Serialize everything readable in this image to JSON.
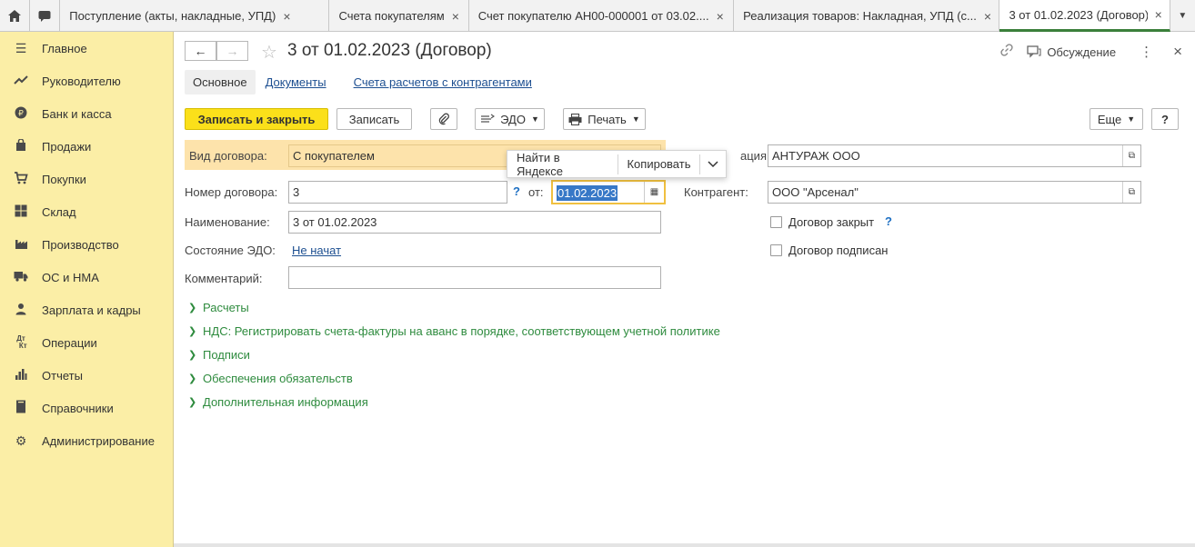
{
  "tabbar": {
    "home_icon": "home-icon",
    "panel_icon": "chat-panel-icon",
    "tabs": [
      {
        "label": "Поступление (акты, накладные, УПД)",
        "close": "×"
      },
      {
        "label": "Счета покупателям",
        "close": "×"
      },
      {
        "label": "Счет покупателю АН00-000001 от 03.02....",
        "close": "×"
      },
      {
        "label": "Реализация товаров: Накладная, УПД (с...",
        "close": "×"
      },
      {
        "label": "3 от 01.02.2023 (Договор)",
        "close": "×"
      }
    ],
    "more": "▼"
  },
  "sidebar": {
    "items": [
      {
        "label": "Главное",
        "icon": "menu-icon"
      },
      {
        "label": "Руководителю",
        "icon": "trend-icon"
      },
      {
        "label": "Банк и касса",
        "icon": "ruble-icon"
      },
      {
        "label": "Продажи",
        "icon": "bag-icon"
      },
      {
        "label": "Покупки",
        "icon": "cart-icon"
      },
      {
        "label": "Склад",
        "icon": "grid-icon"
      },
      {
        "label": "Производство",
        "icon": "factory-icon"
      },
      {
        "label": "ОС и НМА",
        "icon": "truck-icon"
      },
      {
        "label": "Зарплата и кадры",
        "icon": "person-icon"
      },
      {
        "label": "Операции",
        "icon": "dt-kt-icon"
      },
      {
        "label": "Отчеты",
        "icon": "bar-chart-icon"
      },
      {
        "label": "Справочники",
        "icon": "book-icon"
      },
      {
        "label": "Администрирование",
        "icon": "gear-icon"
      }
    ]
  },
  "header": {
    "back": "←",
    "forward": "→",
    "title": "3 от 01.02.2023 (Договор)",
    "discussion": "Обсуждение"
  },
  "subtabs": {
    "main": "Основное",
    "documents": "Документы",
    "accounts": "Счета расчетов с контрагентами"
  },
  "toolbar": {
    "save_close": "Записать и закрыть",
    "save": "Записать",
    "edo": "ЭДО",
    "print": "Печать",
    "more": "Еще",
    "help": "?"
  },
  "form": {
    "type_label": "Вид договора:",
    "type_value": "С покупателем",
    "org_label": "ация:",
    "org_value": "АНТУРАЖ ООО",
    "number_label": "Номер договора:",
    "number_value": "3",
    "number_help": "?",
    "date_label": "от:",
    "date_value": "01.02.2023",
    "counterparty_label": "Контрагент:",
    "counterparty_value": "ООО \"Арсенал\"",
    "name_label": "Наименование:",
    "name_value": "3 от 01.02.2023",
    "edo_state_label": "Состояние ЭДО:",
    "edo_state_value": "Не начат",
    "comment_label": "Комментарий:",
    "comment_value": "",
    "closed_label": "Договор закрыт",
    "closed_help": "?",
    "signed_label": "Договор подписан",
    "closed_checked": false,
    "signed_checked": false
  },
  "context_menu": {
    "find": "Найти в Яндексе",
    "copy": "Копировать"
  },
  "groups": [
    "Расчеты",
    "НДС: Регистрировать счета-фактуры на аванс в порядке, соответствующем учетной политике",
    "Подписи",
    "Обеспечения обязательств",
    "Дополнительная информация"
  ],
  "colors": {
    "sidebar": "#fbeea6",
    "primary_button": "#fbe01a",
    "highlight_row": "#fde3ab",
    "group_text": "#2e8b3e",
    "link": "#1d4f91"
  }
}
